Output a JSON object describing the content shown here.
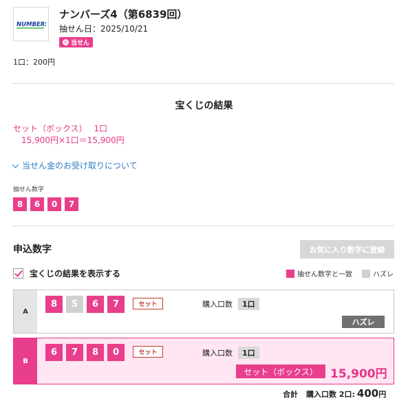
{
  "header": {
    "logo_text": "NUMBERS4",
    "title": "ナンバーズ4（第6839回）",
    "draw_date": "抽せん日：2025/10/21",
    "status_badge": "当せん",
    "unit_price": "1口：200円"
  },
  "result": {
    "section_title": "宝くじの結果",
    "line1": "セット（ボックス）　 1口",
    "line2": "15,900円×1口＝15,900円",
    "prize_link": "当せん金のお受け取りについて"
  },
  "winning": {
    "label": "抽せん数字",
    "numbers": [
      "8",
      "6",
      "0",
      "7"
    ]
  },
  "entry": {
    "title": "申込数字",
    "favorite_button": "お気に入り数字に登録",
    "show_results_label": "宝くじの結果を表示する",
    "legend_match": "抽せん数字と一致",
    "legend_miss": "ハズレ",
    "colors": {
      "match": "#e83e8c",
      "miss": "#d0d0d0"
    },
    "rows": [
      {
        "letter": "A",
        "numbers": [
          "8",
          "5",
          "6",
          "7"
        ],
        "match": [
          true,
          false,
          true,
          true
        ],
        "type": "セット",
        "purchase_label": "購入口数",
        "purchase_count": "1口",
        "result_badge": "ハズレ"
      },
      {
        "letter": "B",
        "numbers": [
          "6",
          "7",
          "8",
          "0"
        ],
        "match": [
          true,
          true,
          true,
          true
        ],
        "type": "セット",
        "purchase_label": "購入口数",
        "purchase_count": "1口",
        "result_badge": "セット（ボックス）",
        "prize": "15,900円"
      }
    ]
  },
  "total": {
    "label": "合計",
    "count": "購入口数 2口:",
    "amount": "400",
    "currency": "円"
  }
}
